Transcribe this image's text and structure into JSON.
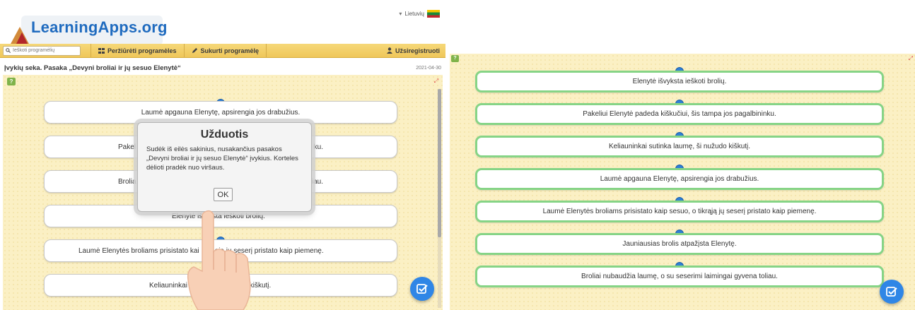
{
  "left": {
    "logo_text": "LearningApps.org",
    "language": "Lietuvių",
    "search_placeholder": "Ieškoti programėlių",
    "nav": {
      "browse_label": "Peržiūrėti programėles",
      "create_label": "Sukurti programėlę",
      "register_label": "Užsiregistruoti"
    },
    "title": "Įvykių seka. Pasaka „Devyni broliai ir jų sesuo Elenytė“",
    "date": "2021-04-30",
    "cards": [
      "Laumė apgauna Elenytę, apsirengia jos drabužius.",
      "Pakel",
      "ku.",
      "Brolia",
      "iau.",
      "Elenytė iš",
      "sta ieškoti brolių.",
      "Laumė Elenytės broliams prisistato kai",
      "ąją jų seserį pristato kaip piemenę.",
      "Keliauninkai su",
      "žudo kiškutį."
    ],
    "dialog": {
      "title": "Užduotis",
      "text": "Sudėk iš eilės sakinius, nusakančius pasakos „Devyni broliai ir jų sesuo Elenytė“ įvykius. Korteles dėlioti pradėk nuo viršaus.",
      "ok_label": "OK"
    }
  },
  "right": {
    "cards": [
      "Elenytė išvyksta ieškoti brolių.",
      "Pakeliui Elenytė padeda kiškučiui, šis tampa jos pagalbininku.",
      "Keliauninkai sutinka laumę, ši nužudo kiškutį.",
      "Laumė apgauna Elenytę, apsirengia jos drabužius.",
      "Laumė Elenytės broliams prisistato kaip sesuo, o tikrąją jų seserį pristato kaip piemenę.",
      "Jauniausias brolis atpažįsta Elenytę.",
      "Broliai nubaudžia laumę, o su seserimi laimingai gyvena toliau."
    ]
  },
  "colors": {
    "accent_blue": "#2f7fd6",
    "nav_yellow": "#f2cf6a",
    "game_bg": "#fbf0c4",
    "correct_green": "#86d486"
  },
  "icons": [
    "search-icon",
    "grid-icon",
    "pencil-icon",
    "user-icon",
    "help-icon",
    "fullscreen-icon",
    "check-icon",
    "chevron-down-icon",
    "flag-icon",
    "hand-pointer-icon"
  ]
}
